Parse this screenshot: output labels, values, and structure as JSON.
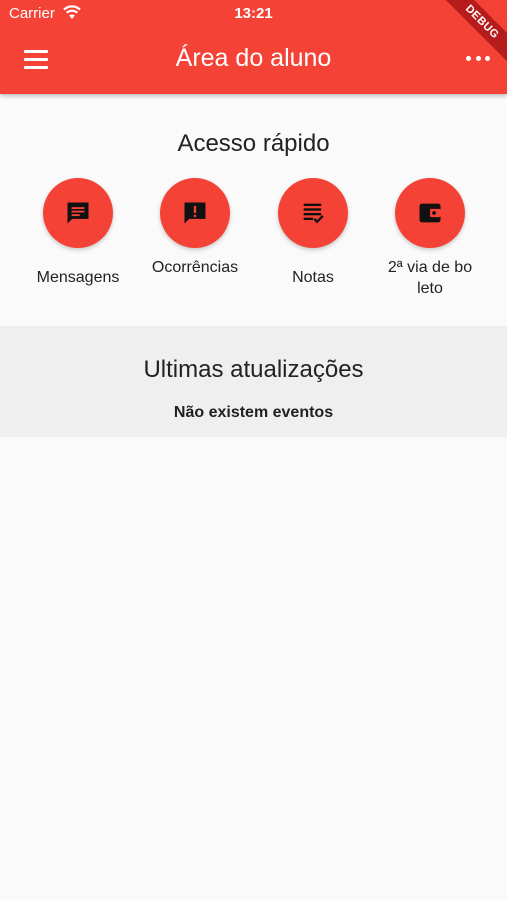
{
  "status_bar": {
    "carrier": "Carrier",
    "time": "13:21"
  },
  "app_bar": {
    "title": "Área do aluno",
    "debug_banner": "DEBUG"
  },
  "quick_access": {
    "title": "Acesso rápido",
    "items": [
      {
        "label": "Mensagens",
        "icon": "message-icon"
      },
      {
        "label": "Ocorrências",
        "icon": "alert-message-icon"
      },
      {
        "label": "Notas",
        "icon": "grades-list-icon"
      },
      {
        "label": "2ª via de boleto",
        "icon": "wallet-icon"
      }
    ]
  },
  "updates": {
    "title": "Ultimas atualizações",
    "empty_message": "Não existem eventos"
  },
  "colors": {
    "primary": "#f44336",
    "banner": "#b71c1c",
    "section_bg": "#efefef",
    "page_bg": "#fafafa"
  }
}
